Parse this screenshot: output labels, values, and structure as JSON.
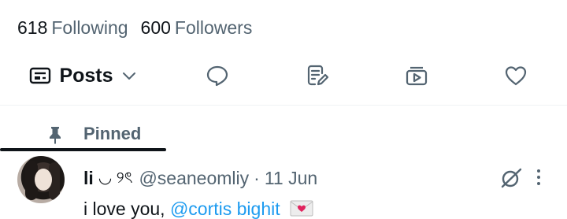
{
  "stats": {
    "following_count": "618",
    "following_label": "Following",
    "followers_count": "600",
    "followers_label": "Followers"
  },
  "tabs": {
    "posts_label": "Posts",
    "items": [
      "posts-icon",
      "replies-icon",
      "articles-icon",
      "media-icon",
      "likes-icon"
    ],
    "active": "Posts"
  },
  "pinned": {
    "label": "Pinned"
  },
  "tweet": {
    "name": "li",
    "name_decoration": "◡ ୨ৎ",
    "handle": "@seaneomliy",
    "separator": "·",
    "date": "11 Jun",
    "text_prefix": "i love you, ",
    "mention": "@cortis bighit",
    "emoji": "love-letter"
  },
  "colors": {
    "primary_text": "#0f1419",
    "secondary_text": "#536471",
    "link": "#1d9bf0",
    "divider": "#eff3f4"
  }
}
